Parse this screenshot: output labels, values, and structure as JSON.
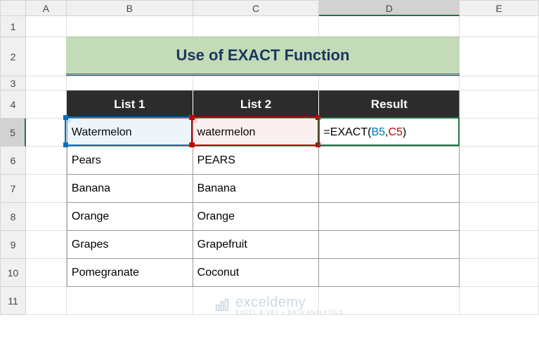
{
  "columns": [
    "A",
    "B",
    "C",
    "D",
    "E"
  ],
  "rows": [
    "1",
    "2",
    "3",
    "4",
    "5",
    "6",
    "7",
    "8",
    "9",
    "10",
    "11"
  ],
  "selected_col": "D",
  "selected_row": "5",
  "title": "Use of EXACT Function",
  "headers": {
    "b": "List 1",
    "c": "List 2",
    "d": "Result"
  },
  "data": {
    "b5": "Watermelon",
    "c5": "watermelon",
    "b6": "Pears",
    "c6": "PEARS",
    "b7": "Banana",
    "c7": "Banana",
    "b8": "Orange",
    "c8": "Orange",
    "b9": "Grapes",
    "c9": "Grapefruit",
    "b10": "Pomegranate",
    "c10": "Coconut"
  },
  "formula": {
    "prefix": "=EXACT(",
    "ref1": "B5",
    "sep": ",",
    "ref2": "C5",
    "suffix": ")"
  },
  "watermark": {
    "brand": "exceldemy",
    "sub": "EXCEL & VBA + DATA ANALYTICS"
  }
}
